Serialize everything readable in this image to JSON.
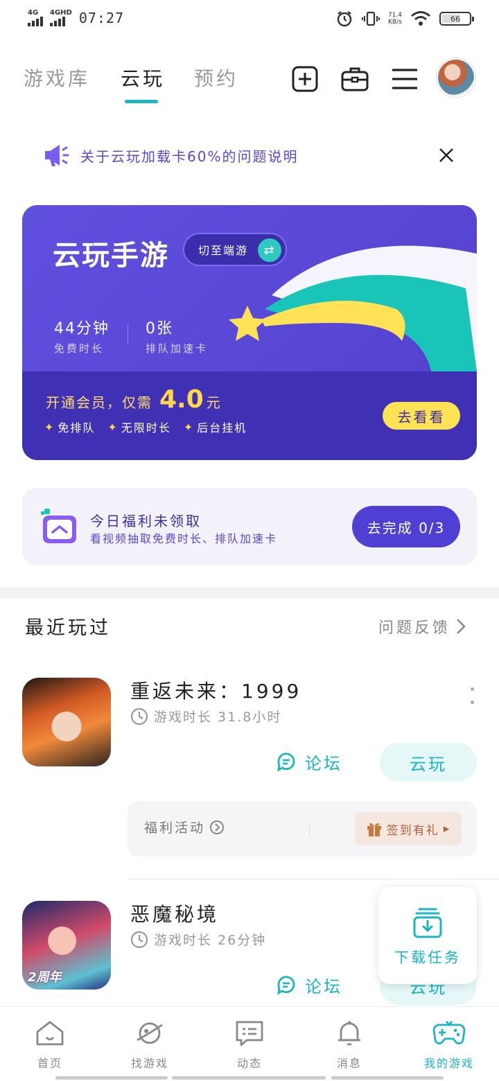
{
  "status_bar": {
    "network1": "4G",
    "network2": "4GHD",
    "time": "07:27",
    "net_speed_value": "71.4",
    "net_speed_unit": "KB/s",
    "battery": "66"
  },
  "header": {
    "tabs": [
      {
        "label": "游戏库"
      },
      {
        "label": "云玩"
      },
      {
        "label": "预约"
      }
    ],
    "active_tab_index": 1
  },
  "notice": {
    "text": "关于云玩加载卡60%的问题说明"
  },
  "banner": {
    "title": "云玩手游",
    "switch_label": "切至端游",
    "stats": [
      {
        "value": "44分钟",
        "label": "免费时长"
      },
      {
        "value": "0张",
        "label": "排队加速卡"
      }
    ],
    "promo_prefix": "开通会员，仅需",
    "promo_price": "4.0",
    "promo_suffix": "元",
    "perks": [
      "免排队",
      "无限时长",
      "后台挂机"
    ],
    "cta": "去看看",
    "colors": {
      "primary": "#5b47d6",
      "accent_yellow": "#ffe255",
      "accent_teal": "#19c4b9"
    }
  },
  "welfare": {
    "title": "今日福利未领取",
    "subtitle": "看视频抽取免费时长、排队加速卡",
    "button": "去完成 0/3"
  },
  "recent": {
    "title": "最近玩过",
    "feedback_link": "问题反馈",
    "games": [
      {
        "name": "重返未来：1999",
        "playtime": "游戏时长 31.8小时",
        "forum_label": "论坛",
        "play_label": "云玩",
        "activity_label": "福利活动",
        "activity_button": "签到有礼"
      },
      {
        "name": "恶魔秘境",
        "playtime": "游戏时长 26分钟",
        "forum_label": "论坛",
        "play_label": "云玩",
        "icon_badge": "2周年"
      }
    ]
  },
  "download_task": {
    "label": "下载任务"
  },
  "bottom_nav": {
    "items": [
      {
        "label": "首页",
        "icon": "home-icon"
      },
      {
        "label": "找游戏",
        "icon": "planet-icon"
      },
      {
        "label": "动态",
        "icon": "chat-icon"
      },
      {
        "label": "消息",
        "icon": "bell-icon"
      },
      {
        "label": "我的游戏",
        "icon": "gamepad-icon"
      }
    ],
    "active_index": 4
  },
  "theme": {
    "teal": "#19b5c4",
    "text_muted": "#999999"
  }
}
